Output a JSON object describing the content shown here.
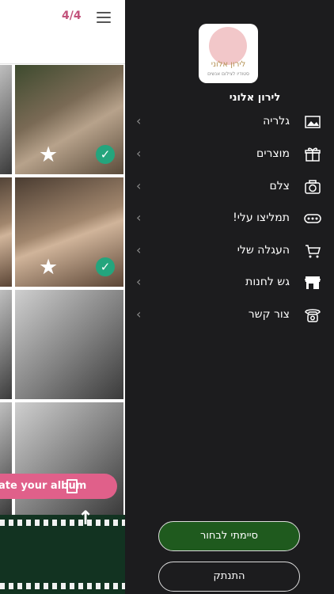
{
  "header": {
    "counter": "4/4"
  },
  "gallery": {
    "create_album_label": "ate your album"
  },
  "sidebar": {
    "logo_title": "לירון אלוני",
    "logo_subtitle": "סטודיו לצילום אנשים",
    "brand_name": "לירון אלוני",
    "items": [
      {
        "label": "גלריה",
        "icon": "gallery-icon"
      },
      {
        "label": "מוצרים",
        "icon": "gift-icon"
      },
      {
        "label": "צלם",
        "icon": "camera-icon"
      },
      {
        "label": "תמליצו עלי!",
        "icon": "more-dots-icon"
      },
      {
        "label": "העגלה שלי",
        "icon": "cart-icon"
      },
      {
        "label": "גש לחנות",
        "icon": "store-icon"
      },
      {
        "label": "צור קשר",
        "icon": "phone-icon"
      }
    ],
    "done_label": "סיימתי לבחור",
    "logout_label": "התנתק"
  },
  "colors": {
    "accent_pink": "#e0608a",
    "check_green": "#24a57d",
    "done_green": "#1f5a1e",
    "drawer_bg": "#1c1c1e"
  }
}
